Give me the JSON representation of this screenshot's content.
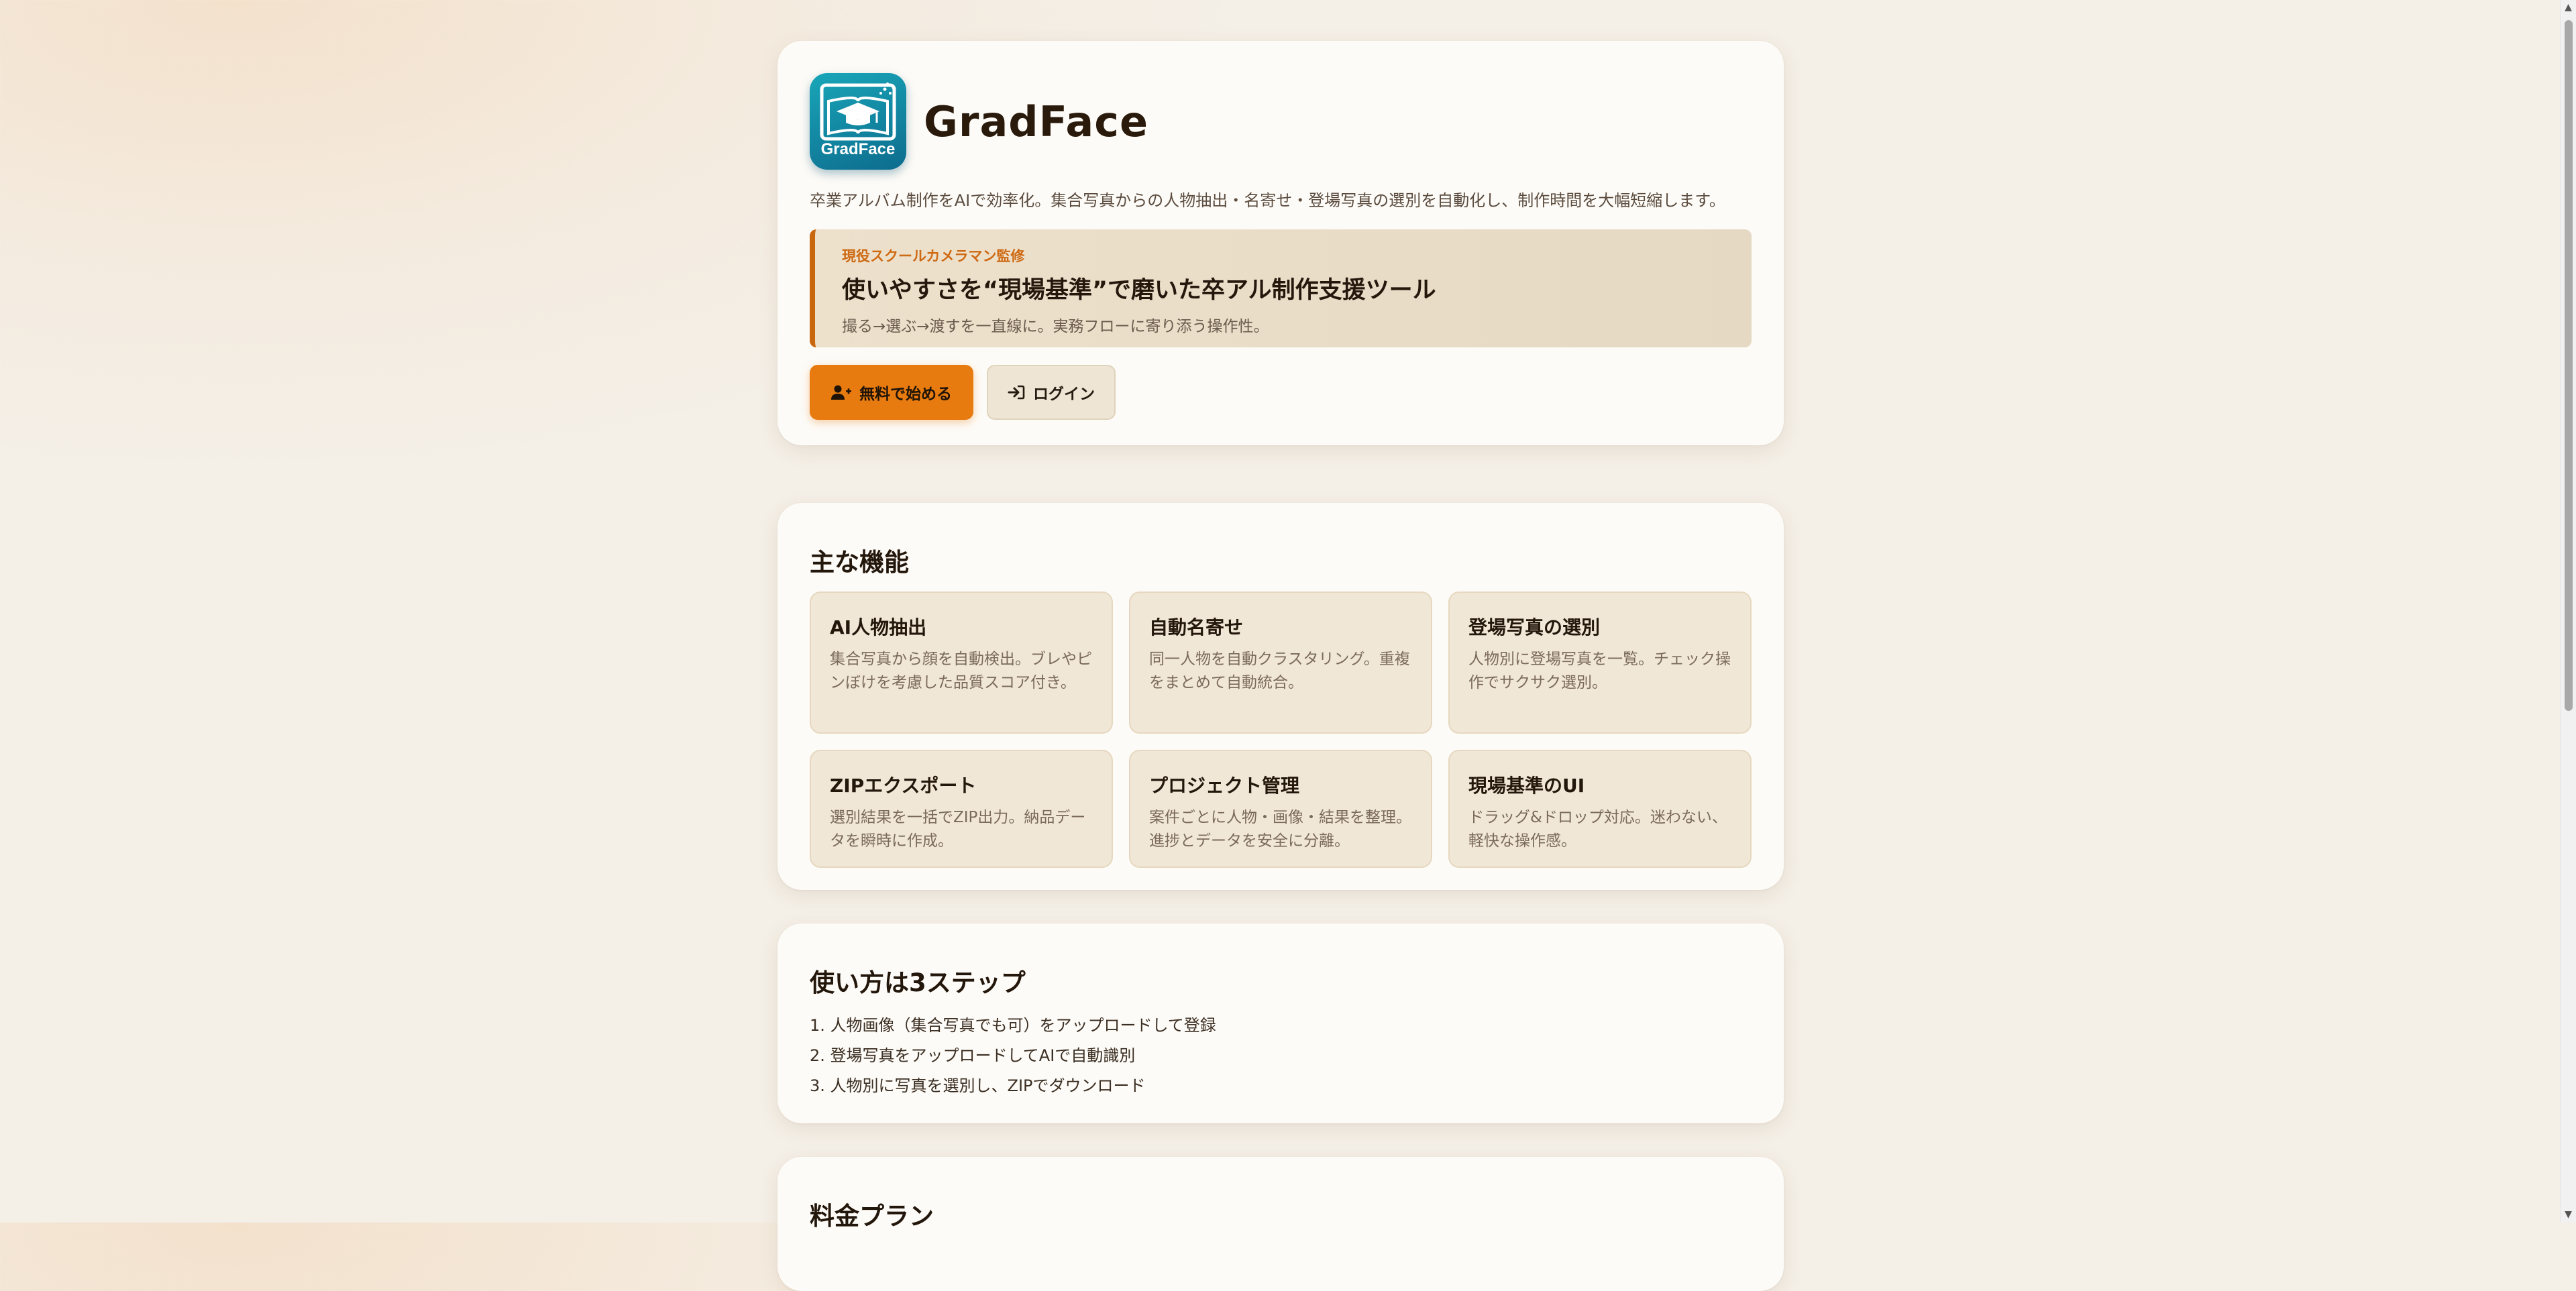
{
  "app": {
    "title": "GradFace",
    "logo_text": "GradFace",
    "tagline": "卒業アルバム制作をAIで効率化。集合写真からの人物抽出・名寄せ・登場写真の選別を自動化し、制作時間を大幅短縮します。"
  },
  "banner": {
    "eyebrow": "現役スクールカメラマン監修",
    "title": "使いやすさを“現場基準”で磨いた卒アル制作支援ツール",
    "description": "撮る→選ぶ→渡すを一直線に。実務フローに寄り添う操作性。"
  },
  "actions": {
    "signup_label": "無料で始める",
    "login_label": "ログイン"
  },
  "features": {
    "title": "主な機能",
    "items": [
      {
        "title": "AI人物抽出",
        "desc": "集合写真から顔を自動検出。ブレやピンぼけを考慮した品質スコア付き。"
      },
      {
        "title": "自動名寄せ",
        "desc": "同一人物を自動クラスタリング。重複をまとめて自動統合。"
      },
      {
        "title": "登場写真の選別",
        "desc": "人物別に登場写真を一覧。チェック操作でサクサク選別。"
      },
      {
        "title": "ZIPエクスポート",
        "desc": "選別結果を一括でZIP出力。納品データを瞬時に作成。"
      },
      {
        "title": "プロジェクト管理",
        "desc": "案件ごとに人物・画像・結果を整理。進捗とデータを安全に分離。"
      },
      {
        "title": "現場基準のUI",
        "desc": "ドラッグ&ドロップ対応。迷わない、軽快な操作感。"
      }
    ]
  },
  "steps": {
    "title": "使い方は3ステップ",
    "items": [
      "1. 人物画像（集合写真でも可）をアップロードして登録",
      "2. 登場写真をアップロードしてAIで自動識別",
      "3. 人物別に写真を選別し、ZIPでダウンロード"
    ]
  },
  "pricing": {
    "title": "料金プラン"
  },
  "colors": {
    "accent": "#e77b0f",
    "banner_border": "#c8670d",
    "logo": "#0d6c8e"
  },
  "icons": {
    "signup": "user-plus-icon",
    "login": "sign-in-icon",
    "logo": "graduation-cap-book-icon"
  }
}
